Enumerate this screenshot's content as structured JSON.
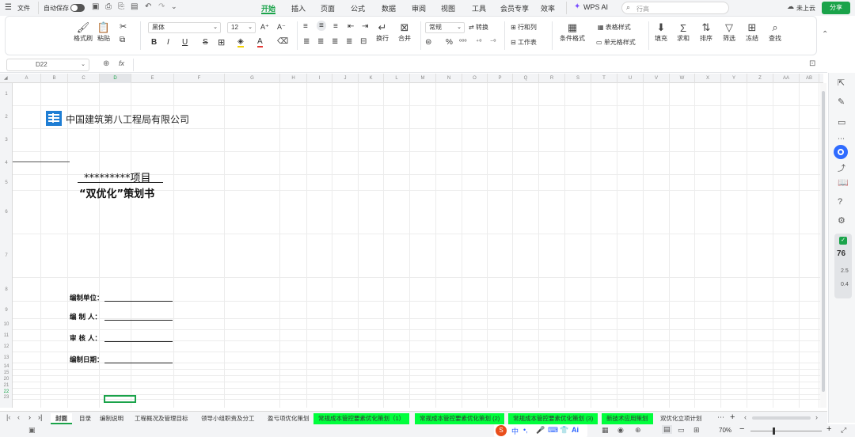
{
  "topbar": {
    "file_menu": "文件",
    "autosave": "自动保存",
    "tabs": [
      "开始",
      "插入",
      "页面",
      "公式",
      "数据",
      "审阅",
      "视图",
      "工具",
      "会员专享",
      "效率"
    ],
    "active_tab": "开始",
    "wps_ai": "WPS AI",
    "search_placeholder": "行高",
    "cloud_status": "未上云",
    "share": "分享",
    "accent": "#1aa34a"
  },
  "ribbon": {
    "format_painter": "格式刷",
    "paste": "粘贴",
    "font_name": "黑体",
    "font_size": "12",
    "bold": "B",
    "italic": "I",
    "underline": "U",
    "strike": "S",
    "wrap": "换行",
    "merge": "合并",
    "number_format": "常规",
    "convert": "转换",
    "rows_cols": "行和列",
    "worksheet": "工作表",
    "table_style": "表格样式",
    "cond_format": "条件格式",
    "cell_style": "单元格样式",
    "fill": "填充",
    "sum": "求和",
    "sort": "排序",
    "filter": "筛选",
    "freeze": "冻结",
    "find": "查找"
  },
  "formula_bar": {
    "cell_ref": "D22",
    "fx": "fx"
  },
  "columns": [
    "A",
    "B",
    "C",
    "D",
    "E",
    "F",
    "G",
    "H",
    "I",
    "J",
    "K",
    "L",
    "M",
    "N",
    "O",
    "P",
    "Q",
    "R",
    "S",
    "T",
    "U",
    "V",
    "W",
    "X",
    "Y",
    "Z",
    "AA",
    "AB"
  ],
  "rows": [
    "1",
    "2",
    "3",
    "4",
    "5",
    "6",
    "7",
    "8",
    "9",
    "10",
    "11",
    "12",
    "13",
    "14",
    "15",
    "20",
    "21",
    "22",
    "23"
  ],
  "document": {
    "company": "中国建筑第八工程局有限公司",
    "project_title": "*********项目",
    "plan_title": "“双优化”策划书",
    "fields": [
      "编制单位：",
      "编  制  人：",
      "审  核  人：",
      "编制日期："
    ]
  },
  "sheets": [
    {
      "name": "封面",
      "active": true,
      "highlight": false
    },
    {
      "name": "目录",
      "active": false,
      "highlight": false
    },
    {
      "name": "编制说明",
      "active": false,
      "highlight": false
    },
    {
      "name": "工程概况及管理目标",
      "active": false,
      "highlight": false
    },
    {
      "name": "领导小组职责及分工",
      "active": false,
      "highlight": false
    },
    {
      "name": "盈亏项优化策划",
      "active": false,
      "highlight": false
    },
    {
      "name": "常规成本管控要素优化策划（1）",
      "active": false,
      "highlight": true
    },
    {
      "name": "常规成本管控要素优化策划 (2)",
      "active": false,
      "highlight": true
    },
    {
      "name": "常规成本管控要素优化策划 (3)",
      "active": false,
      "highlight": true
    },
    {
      "name": "新技术应用策划",
      "active": false,
      "highlight": true
    },
    {
      "name": "双优化立项计划",
      "active": false,
      "highlight": false
    }
  ],
  "status": {
    "zoom": "70%",
    "perf_score": "76",
    "net_up": "2.5",
    "net_down": "0.4"
  }
}
